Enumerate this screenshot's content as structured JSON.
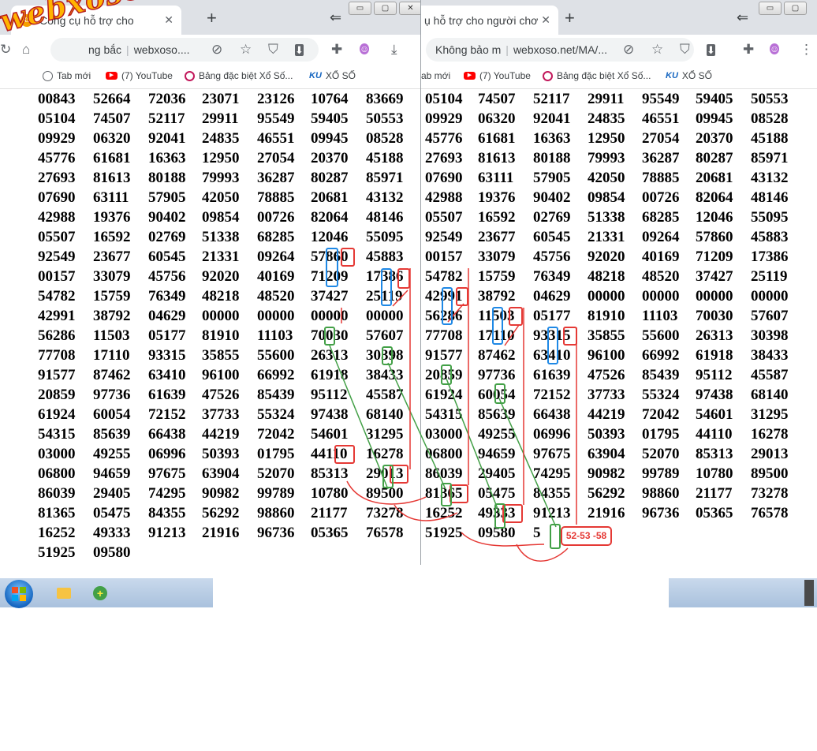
{
  "left_window": {
    "tab_title": "Công cụ hỗ trợ cho",
    "tab_favicon": "XS",
    "omnibox_segment": "ng bắc",
    "omnibox_url": "webxoso....",
    "bookmarks": [
      "Tab mới",
      "(7) YouTube",
      "Bảng đặc biệt Xổ Số...",
      "XỔ SỐ"
    ]
  },
  "right_window": {
    "tab_title": "ụ hỗ trợ cho người chơ",
    "omnibox_security": "Không bảo m",
    "omnibox_url": "webxoso.net/MA/...",
    "bookmarks": [
      "ab mới",
      "(7) YouTube",
      "Bảng đặc biệt Xổ Số...",
      "XỔ SỐ"
    ]
  },
  "common": {
    "close_glyph": "✕",
    "newtab_glyph": "+",
    "back_glyph": "⇐",
    "min_glyph": "▭",
    "max_glyph": "▢",
    "close_win_glyph": "✕",
    "ku_label": "KU"
  },
  "watermark": "webxoso.net",
  "callout_label": "52-53 -58",
  "left_rows": [
    [
      "00843",
      "52664",
      "72036",
      "23071",
      "23126",
      "10764",
      "83669"
    ],
    [
      "05104",
      "74507",
      "52117",
      "29911",
      "95549",
      "59405",
      "50553"
    ],
    [
      "09929",
      "06320",
      "92041",
      "24835",
      "46551",
      "09945",
      "08528"
    ],
    [
      "45776",
      "61681",
      "16363",
      "12950",
      "27054",
      "20370",
      "45188"
    ],
    [
      "27693",
      "81613",
      "80188",
      "79993",
      "36287",
      "80287",
      "85971"
    ],
    [
      "07690",
      "63111",
      "57905",
      "42050",
      "78885",
      "20681",
      "43132"
    ],
    [
      "42988",
      "19376",
      "90402",
      "09854",
      "00726",
      "82064",
      "48146"
    ],
    [
      "05507",
      "16592",
      "02769",
      "51338",
      "68285",
      "12046",
      "55095"
    ],
    [
      "92549",
      "23677",
      "60545",
      "21331",
      "09264",
      "57860",
      "45883"
    ],
    [
      "00157",
      "33079",
      "45756",
      "92020",
      "40169",
      "71209",
      "17386"
    ],
    [
      "54782",
      "15759",
      "76349",
      "48218",
      "48520",
      "37427",
      "25119"
    ],
    [
      "42991",
      "38792",
      "04629",
      "00000",
      "00000",
      "00000",
      "00000"
    ],
    [
      "56286",
      "11503",
      "05177",
      "81910",
      "11103",
      "70030",
      "57607"
    ],
    [
      "77708",
      "17110",
      "93315",
      "35855",
      "55600",
      "26313",
      "30398"
    ],
    [
      "91577",
      "87462",
      "63410",
      "96100",
      "66992",
      "61918",
      "38433"
    ],
    [
      "20859",
      "97736",
      "61639",
      "47526",
      "85439",
      "95112",
      "45587"
    ],
    [
      "61924",
      "60054",
      "72152",
      "37733",
      "55324",
      "97438",
      "68140"
    ],
    [
      "54315",
      "85639",
      "66438",
      "44219",
      "72042",
      "54601",
      "31295"
    ],
    [
      "03000",
      "49255",
      "06996",
      "50393",
      "01795",
      "44110",
      "16278"
    ],
    [
      "06800",
      "94659",
      "97675",
      "63904",
      "52070",
      "85313",
      "29013"
    ],
    [
      "86039",
      "29405",
      "74295",
      "90982",
      "99789",
      "10780",
      "89500"
    ],
    [
      "81365",
      "05475",
      "84355",
      "56292",
      "98860",
      "21177",
      "73278"
    ],
    [
      "16252",
      "49333",
      "91213",
      "21916",
      "96736",
      "05365",
      "76578"
    ],
    [
      "51925",
      "09580"
    ]
  ],
  "right_rows": [
    [
      "05104",
      "74507",
      "52117",
      "29911",
      "95549",
      "59405",
      "50553"
    ],
    [
      "09929",
      "06320",
      "92041",
      "24835",
      "46551",
      "09945",
      "08528"
    ],
    [
      "45776",
      "61681",
      "16363",
      "12950",
      "27054",
      "20370",
      "45188"
    ],
    [
      "27693",
      "81613",
      "80188",
      "79993",
      "36287",
      "80287",
      "85971"
    ],
    [
      "07690",
      "63111",
      "57905",
      "42050",
      "78885",
      "20681",
      "43132"
    ],
    [
      "42988",
      "19376",
      "90402",
      "09854",
      "00726",
      "82064",
      "48146"
    ],
    [
      "05507",
      "16592",
      "02769",
      "51338",
      "68285",
      "12046",
      "55095"
    ],
    [
      "92549",
      "23677",
      "60545",
      "21331",
      "09264",
      "57860",
      "45883"
    ],
    [
      "00157",
      "33079",
      "45756",
      "92020",
      "40169",
      "71209",
      "17386"
    ],
    [
      "54782",
      "15759",
      "76349",
      "48218",
      "48520",
      "37427",
      "25119"
    ],
    [
      "42991",
      "38792",
      "04629",
      "00000",
      "00000",
      "00000",
      "00000"
    ],
    [
      "56286",
      "11503",
      "05177",
      "81910",
      "11103",
      "70030",
      "57607"
    ],
    [
      "77708",
      "17110",
      "93315",
      "35855",
      "55600",
      "26313",
      "30398"
    ],
    [
      "91577",
      "87462",
      "63410",
      "96100",
      "66992",
      "61918",
      "38433"
    ],
    [
      "20859",
      "97736",
      "61639",
      "47526",
      "85439",
      "95112",
      "45587"
    ],
    [
      "61924",
      "60054",
      "72152",
      "37733",
      "55324",
      "97438",
      "68140"
    ],
    [
      "54315",
      "85639",
      "66438",
      "44219",
      "72042",
      "54601",
      "31295"
    ],
    [
      "03000",
      "49255",
      "06996",
      "50393",
      "01795",
      "44110",
      "16278"
    ],
    [
      "06800",
      "94659",
      "97675",
      "63904",
      "52070",
      "85313",
      "29013"
    ],
    [
      "86039",
      "29405",
      "74295",
      "90982",
      "99789",
      "10780",
      "89500"
    ],
    [
      "81365",
      "05475",
      "84355",
      "56292",
      "98860",
      "21177",
      "73278"
    ],
    [
      "16252",
      "49333",
      "91213",
      "21916",
      "96736",
      "05365",
      "76578"
    ],
    [
      "51925",
      "09580",
      "5"
    ]
  ]
}
